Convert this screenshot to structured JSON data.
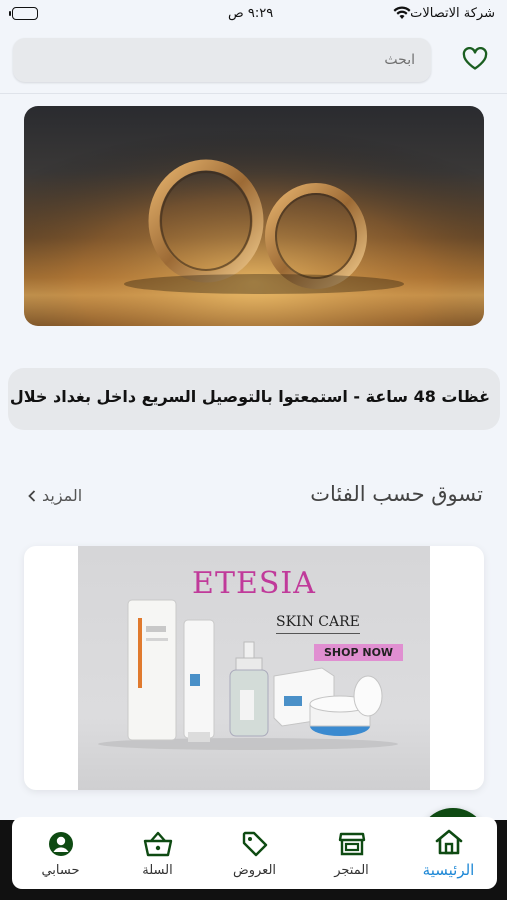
{
  "status_bar": {
    "carrier": "شركة الاتصالات",
    "time": "٩:٢٩ ص"
  },
  "search": {
    "placeholder": "ابحث"
  },
  "ticker": {
    "text": "غظات 48 ساعة     - استمعتوا بالتوصيل السريع داخل بغداد خلال"
  },
  "categories_section": {
    "title": "تسوق حسب الفئات",
    "more_label": "المزيد"
  },
  "category_card": {
    "brand": "ETESIA",
    "subtitle": "SKIN CARE",
    "cta": "SHOP NOW"
  },
  "bottom_nav": {
    "items": [
      {
        "label": "الرئيسية",
        "icon": "home-icon",
        "active": true
      },
      {
        "label": "المتجر",
        "icon": "store-icon",
        "active": false
      },
      {
        "label": "العروض",
        "icon": "tag-icon",
        "active": false
      },
      {
        "label": "السلة",
        "icon": "basket-icon",
        "active": false
      },
      {
        "label": "حسابي",
        "icon": "account-icon",
        "active": false
      }
    ]
  },
  "colors": {
    "primary_green": "#0e4a12",
    "active_nav": "#1e88d6",
    "brand_pink": "#c03a9a"
  }
}
